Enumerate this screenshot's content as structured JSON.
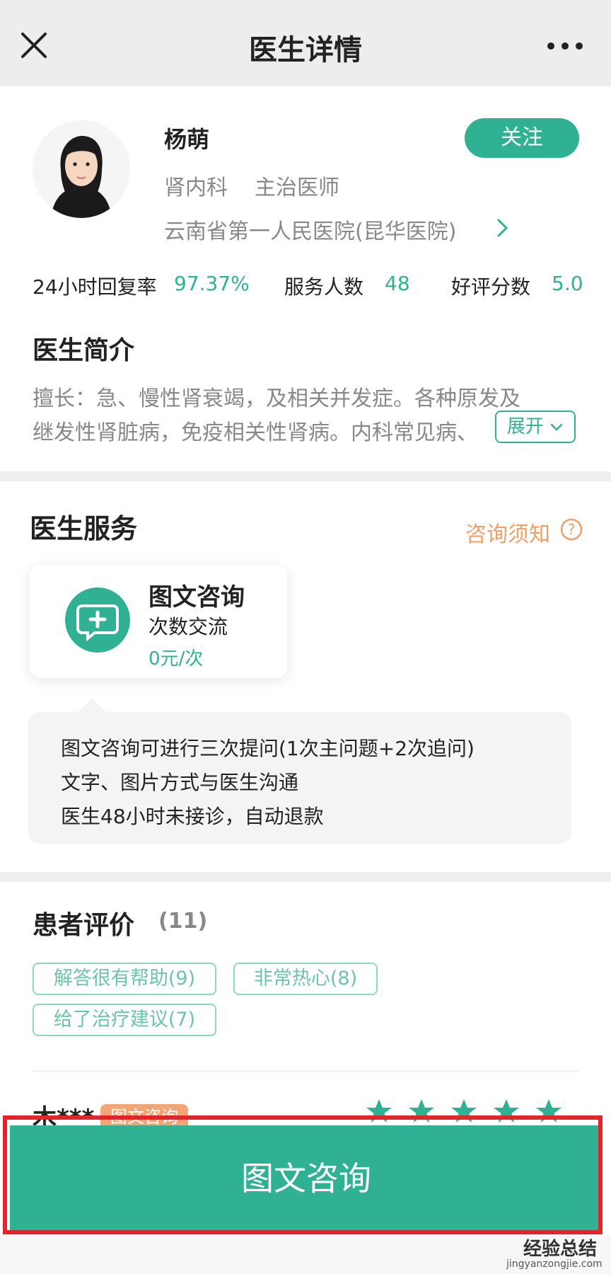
{
  "header": {
    "title": "医生详情",
    "close_icon": "close-icon",
    "more_icon": "more-icon"
  },
  "doctor": {
    "name": "杨萌",
    "department": "肾内科",
    "title": "主治医师",
    "hospital": "云南省第一人民医院(昆华医院)",
    "follow_label": "关注"
  },
  "stats": [
    {
      "label": "24小时回复率",
      "value": "97.37%"
    },
    {
      "label": "服务人数",
      "value": "48"
    },
    {
      "label": "好评分数",
      "value": "5.0"
    }
  ],
  "intro": {
    "title": "医生简介",
    "line1": "擅长：急、慢性肾衰竭，及相关并发症。各种原发及",
    "line2": "继发性肾脏病，免疫相关性肾病。内科常见病、",
    "expand_label": "展开"
  },
  "service": {
    "title": "医生服务",
    "notice_label": "咨询须知",
    "card": {
      "name": "图文咨询",
      "desc": "次数交流",
      "price": "0元/次"
    },
    "info_lines": [
      "图文咨询可进行三次提问(1次主问题+2次追问)",
      "文字、图片方式与医生沟通",
      "医生48小时未接诊，自动退款"
    ]
  },
  "reviews": {
    "title": "患者评价",
    "count": "(11)",
    "tags": [
      "解答很有帮助(9)",
      "非常热心(8)",
      "给了治疗建议(7)"
    ],
    "first": {
      "name": "木***",
      "type_badge": "图文咨询",
      "stars": 5
    }
  },
  "bottom": {
    "consult_label": "图文咨询"
  },
  "watermark": {
    "main": "经验总结",
    "url": "jingyanzongjie.com"
  },
  "colors": {
    "accent": "#31b193",
    "orange": "#eea067",
    "highlight": "#e3242b"
  }
}
